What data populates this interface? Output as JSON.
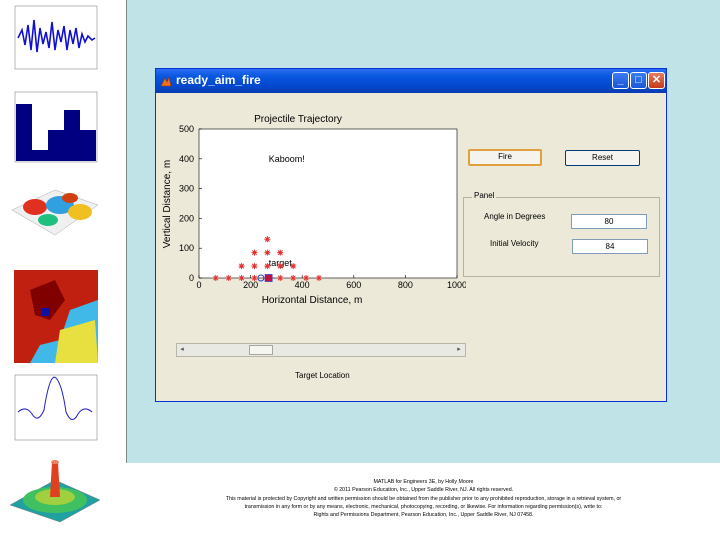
{
  "window": {
    "title": "ready_aim_fire"
  },
  "buttons": {
    "fire_label": "Fire",
    "reset_label": "Reset"
  },
  "panel": {
    "title": "Panel",
    "angle_label": "Angle in Degrees",
    "angle_value": "80",
    "velocity_label": "Initial Velocity",
    "velocity_value": "84"
  },
  "slider": {
    "label": "Target Location",
    "value_fraction": 0.27
  },
  "chart_data": {
    "type": "scatter",
    "title": "Projectile Trajectory",
    "xlabel": "Horizontal Distance, m",
    "ylabel": "Vertical Distance, m",
    "xlim": [
      0,
      1000
    ],
    "ylim": [
      0,
      500
    ],
    "xticks": [
      "0",
      "200",
      "400",
      "600",
      "800",
      "1000"
    ],
    "yticks": [
      "0",
      "100",
      "200",
      "300",
      "400",
      "500"
    ],
    "annotations": [
      {
        "text": "Kaboom!",
        "x": 340,
        "y": 400
      },
      {
        "text": "target",
        "x": 315,
        "y": 50
      }
    ],
    "series": [
      {
        "marker": "asterisk",
        "color": "#e03030",
        "x": [
          65,
          115,
          165,
          215,
          265,
          315,
          365,
          415,
          465,
          165,
          215,
          265,
          315,
          365,
          215,
          265,
          315,
          265
        ],
        "y": [
          0,
          0,
          0,
          0,
          0,
          0,
          0,
          0,
          0,
          40,
          40,
          40,
          40,
          40,
          85,
          85,
          85,
          130
        ]
      },
      {
        "marker": "circle",
        "color": "#3040c0",
        "x": [
          240
        ],
        "y": [
          0
        ]
      },
      {
        "marker": "square",
        "color": "#c01040",
        "x": [
          270
        ],
        "y": [
          0
        ]
      }
    ]
  },
  "caption": {
    "line1": "MATLAB for Engineers 3E, by Holly Moore",
    "line2": "© 2011 Pearson Education, Inc., Upper Saddle River, NJ.  All rights reserved.",
    "line3": "This material is protected by Copyright and written permission should be obtained from the publisher prior to any prohibited reproduction, storage in a retrieval system, or",
    "line4": "transmission in any form or by any means, electronic, mechanical, photocopying, recording, or likewise. For information regarding permission(s), write to:",
    "line5": "Rights and Permissions Department, Pearson Education, Inc., Upper Saddle River, NJ 07458."
  }
}
